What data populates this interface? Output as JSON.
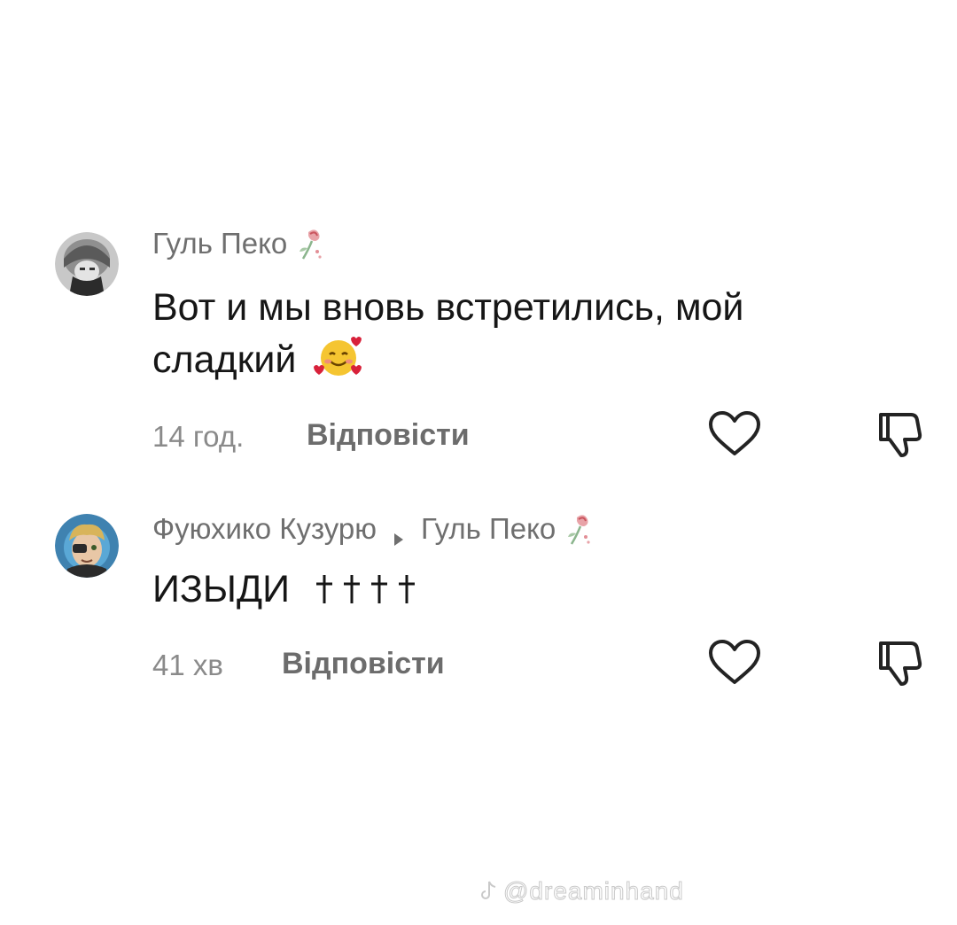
{
  "comments": [
    {
      "author": "Гуль Пеко",
      "author_badge_icon": "wilted-rose-icon",
      "text": "Вот и мы вновь встретились, мой сладкий",
      "text_line1": "Вот и мы вновь встретились, мой",
      "text_line2": "сладкий",
      "emoji_icon": "smiling-face-with-hearts-icon",
      "time": "14 год.",
      "reply_label": "Відповісти"
    },
    {
      "author": "Фуюхико Кузурю",
      "reply_to": "Гуль Пеко",
      "reply_to_badge_icon": "wilted-rose-icon",
      "text": "ИЗЫДИ",
      "text_decoration_icon": "cross-icons",
      "time": "41 хв",
      "reply_label": "Відповісти"
    }
  ],
  "watermark": "@dreaminhand",
  "colors": {
    "text": "#161616",
    "secondary_text": "#6f6f6f",
    "meta_text": "#8a8a8a",
    "background": "#ffffff"
  }
}
